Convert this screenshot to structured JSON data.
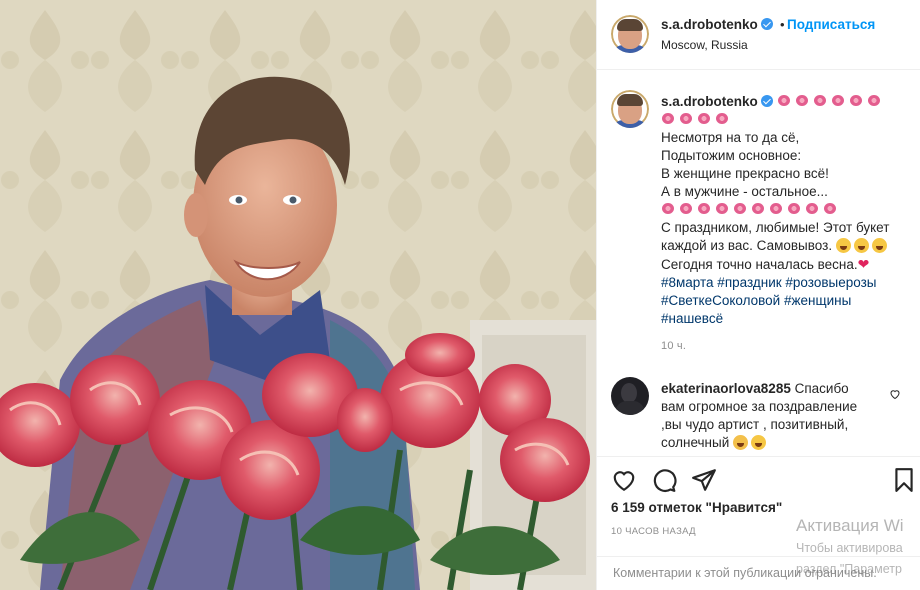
{
  "post": {
    "username": "s.a.drobotenko",
    "follow_label": "Подписаться",
    "dot": "•",
    "location": "Moscow, Russia"
  },
  "caption": {
    "username": "s.a.drobotenko",
    "lines": [
      "Несмотря на то да сё,",
      "Подытожим основное:",
      "В женщине прекрасно всё!",
      "А в мужчине - остальное...",
      "С праздником, любимые! Этот букет",
      "каждой из вас. Самовывоз.",
      "Сегодня точно началась весна."
    ],
    "hashtags_line1": "#8марта #праздник #розовыерозы",
    "hashtags_line2": "#СветкеСоколовой #женщины",
    "hashtags_line3": "#нашевсё",
    "time": "10 ч."
  },
  "comment": {
    "username": "ekaterinaorlova8285",
    "text_1": " Спасибо",
    "text_2": "вам огромное за поздравление",
    "text_3": ",вы чудо артист , позитивный,",
    "text_4": "солнечный"
  },
  "footer": {
    "likes": "6 159 отметок \"Нравится\"",
    "posted": "10 ЧАСОВ НАЗАД",
    "comments_closed": "Комментарии к этой публикации ограничены."
  },
  "watermark": {
    "title": "Активация Wi",
    "line1": "Чтобы активирова",
    "line2": "раздел \"Параметр"
  },
  "icons": {
    "verified": "verified-badge-icon",
    "like": "heart-outline-icon",
    "comment": "comment-bubble-icon",
    "share": "paper-plane-icon",
    "save": "bookmark-icon"
  },
  "colors": {
    "link_blue": "#0095f6",
    "hashtag": "#00376b",
    "verified": "#3897f0",
    "muted": "#8e8e8e"
  }
}
